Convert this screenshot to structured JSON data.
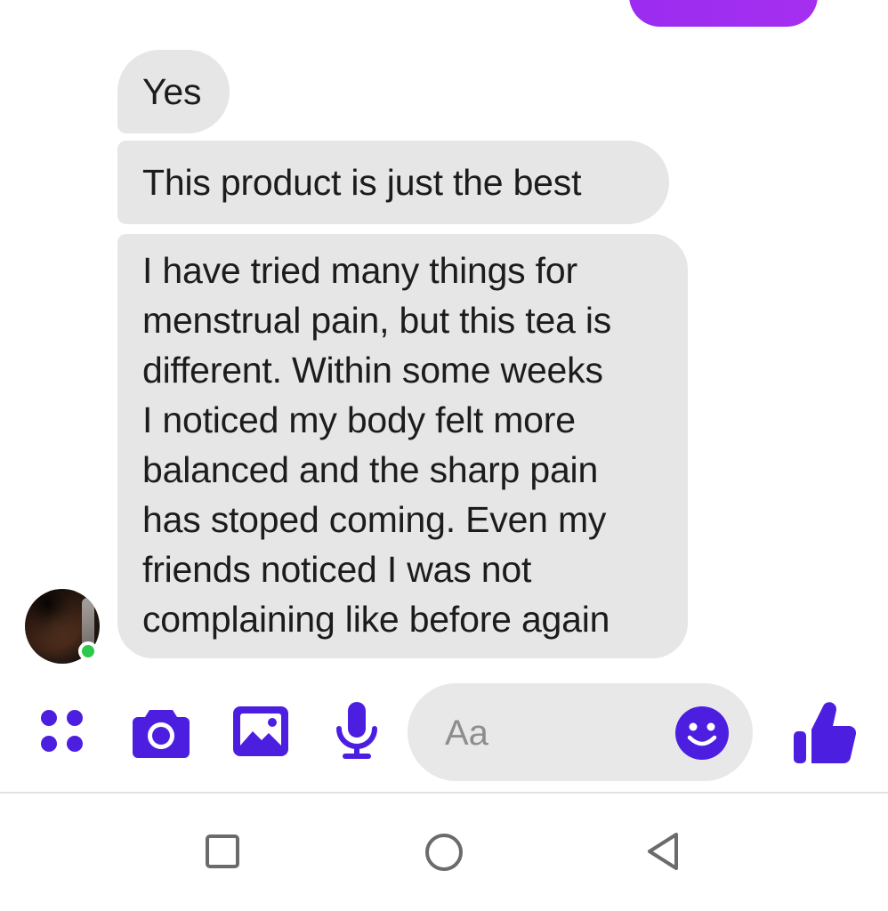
{
  "messages": [
    {
      "text": "Yes"
    },
    {
      "text": "This product is just the best"
    },
    {
      "text": "I have tried many things for\nmenstrual pain, but this tea is\ndifferent. Within some weeks\nI noticed my body felt more\nbalanced and the sharp pain\nhas stoped coming. Even my\nfriends noticed I was not\ncomplaining like before again"
    }
  ],
  "composer": {
    "placeholder": "Aa",
    "icons": [
      "apps-icon",
      "camera-icon",
      "gallery-icon",
      "microphone-icon",
      "emoji-icon",
      "like-icon"
    ]
  },
  "navigation": {
    "icons": [
      "recent-apps-icon",
      "home-icon",
      "back-icon"
    ]
  },
  "colors": {
    "accent": "#4c1fe0",
    "sent_bubble": "#a32ff0",
    "received_bubble": "#e6e6e7",
    "online": "#2cc84a"
  }
}
